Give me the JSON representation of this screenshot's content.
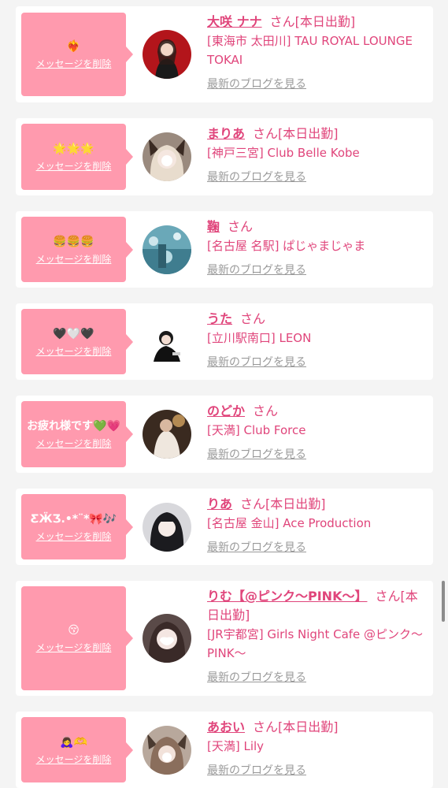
{
  "delete_label": "メッセージを削除",
  "blog_label": "最新のブログを見る",
  "san_label": "さん",
  "colors": {
    "accent": "#e0457b",
    "bubble": "#ff9aae",
    "muted": "#9a9a9a"
  },
  "entries": [
    {
      "message": "❤️‍🔥",
      "name": "大咲 ナナ",
      "status": "[本日出勤]",
      "shop": "[東海市 太田川] TAU ROYAL LOUNGE TOKAI"
    },
    {
      "message": "🌟🌟🌟",
      "name": "まりあ",
      "status": "[本日出勤]",
      "shop": "[神戸三宮] Club Belle Kobe"
    },
    {
      "message": "🍔🍔🍔",
      "name": "鞠",
      "status": "",
      "shop": "[名古屋 名駅] ぱじゃまじゃま"
    },
    {
      "message": "🖤🤍🖤",
      "name": "うた",
      "status": "",
      "shop": "[立川駅南口] LEON"
    },
    {
      "message": "お疲れ様です💚💗",
      "name": "のどか",
      "status": "",
      "shop": "[天満] Club Force"
    },
    {
      "message": "ƸӜƷ.•*¨*🎀🎶",
      "name": "りあ",
      "status": "[本日出勤]",
      "shop": "[名古屋 金山] Ace Production"
    },
    {
      "message": "😚",
      "name": "りむ【@ピンク〜PINK〜】",
      "status": "[本日出勤]",
      "shop": "[JR宇都宮] Girls Night Cafe @ピンク〜PINK〜"
    },
    {
      "message": "🙇‍♀️🫶",
      "name": "あおい",
      "status": "[本日出勤]",
      "shop": "[天満] Lily"
    }
  ]
}
